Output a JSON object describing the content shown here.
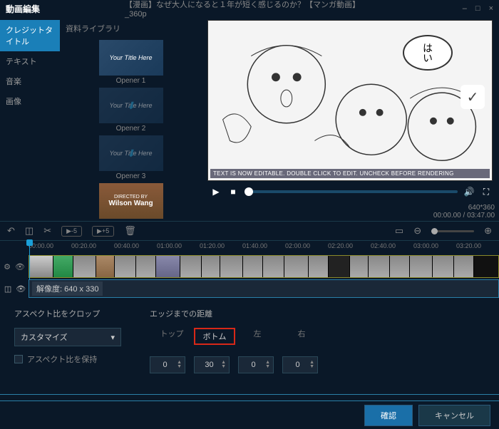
{
  "titlebar": {
    "app": "動画編集",
    "file": "【漫画】なぜ大人になると１年が短く感じるのか？【マンガ動画】_360p"
  },
  "win": {
    "min": "–",
    "max": "□",
    "close": "×"
  },
  "sidebar": {
    "tabs": [
      "クレジットタイトル",
      "テキスト",
      "音楽",
      "画像"
    ],
    "lib_tab": "資料ライブラリ",
    "thumbs": [
      {
        "text": "Your Title Here",
        "label": "Opener 1"
      },
      {
        "text": "Your Title Here",
        "label": "Opener 2"
      },
      {
        "text": "Your Title Here",
        "label": "Opener 3"
      },
      {
        "d1": "DIRECTED BY",
        "d2": "Wilson Wang",
        "label": ""
      }
    ]
  },
  "preview": {
    "bubble": "はい",
    "editable": "TEXT IS NOW EDITABLE. DOUBLE CLICK TO EDIT. UNCHECK BEFORE RENDERING",
    "check": "✓",
    "res": "640*360",
    "time": "00:00.00 / 03:47.00",
    "play": "▶",
    "stop": "■",
    "vol": "🔊",
    "full": "⛶"
  },
  "toolbar": {
    "undo": "↶",
    "crop": "◫",
    "cut": "✂",
    "b5": "▶-5",
    "f5": "▶+5",
    "del": "🗑",
    "fit": "▭",
    "zo": "⊖",
    "zi": "⊕"
  },
  "ruler": [
    "00:00.00",
    "00:20.00",
    "00:40.00",
    "01:00.00",
    "01:20.00",
    "01:40.00",
    "02:00.00",
    "02:20.00",
    "02:40.00",
    "03:00.00",
    "03:20.00"
  ],
  "crop_bar": {
    "label": "解像度: 640 x 330",
    "i1": "◫",
    "i2": "👁"
  },
  "panel": {
    "left_title": "アスペクト比をクロップ",
    "select": "カスタマイズ",
    "keep": "アスペクト比を保持",
    "right_title": "エッジまでの距離",
    "edges": [
      "トップ",
      "ボトム",
      "左",
      "右"
    ],
    "vals": [
      "0",
      "30",
      "0",
      "0"
    ]
  },
  "footer": {
    "ok": "確認",
    "cancel": "キャンセル"
  }
}
